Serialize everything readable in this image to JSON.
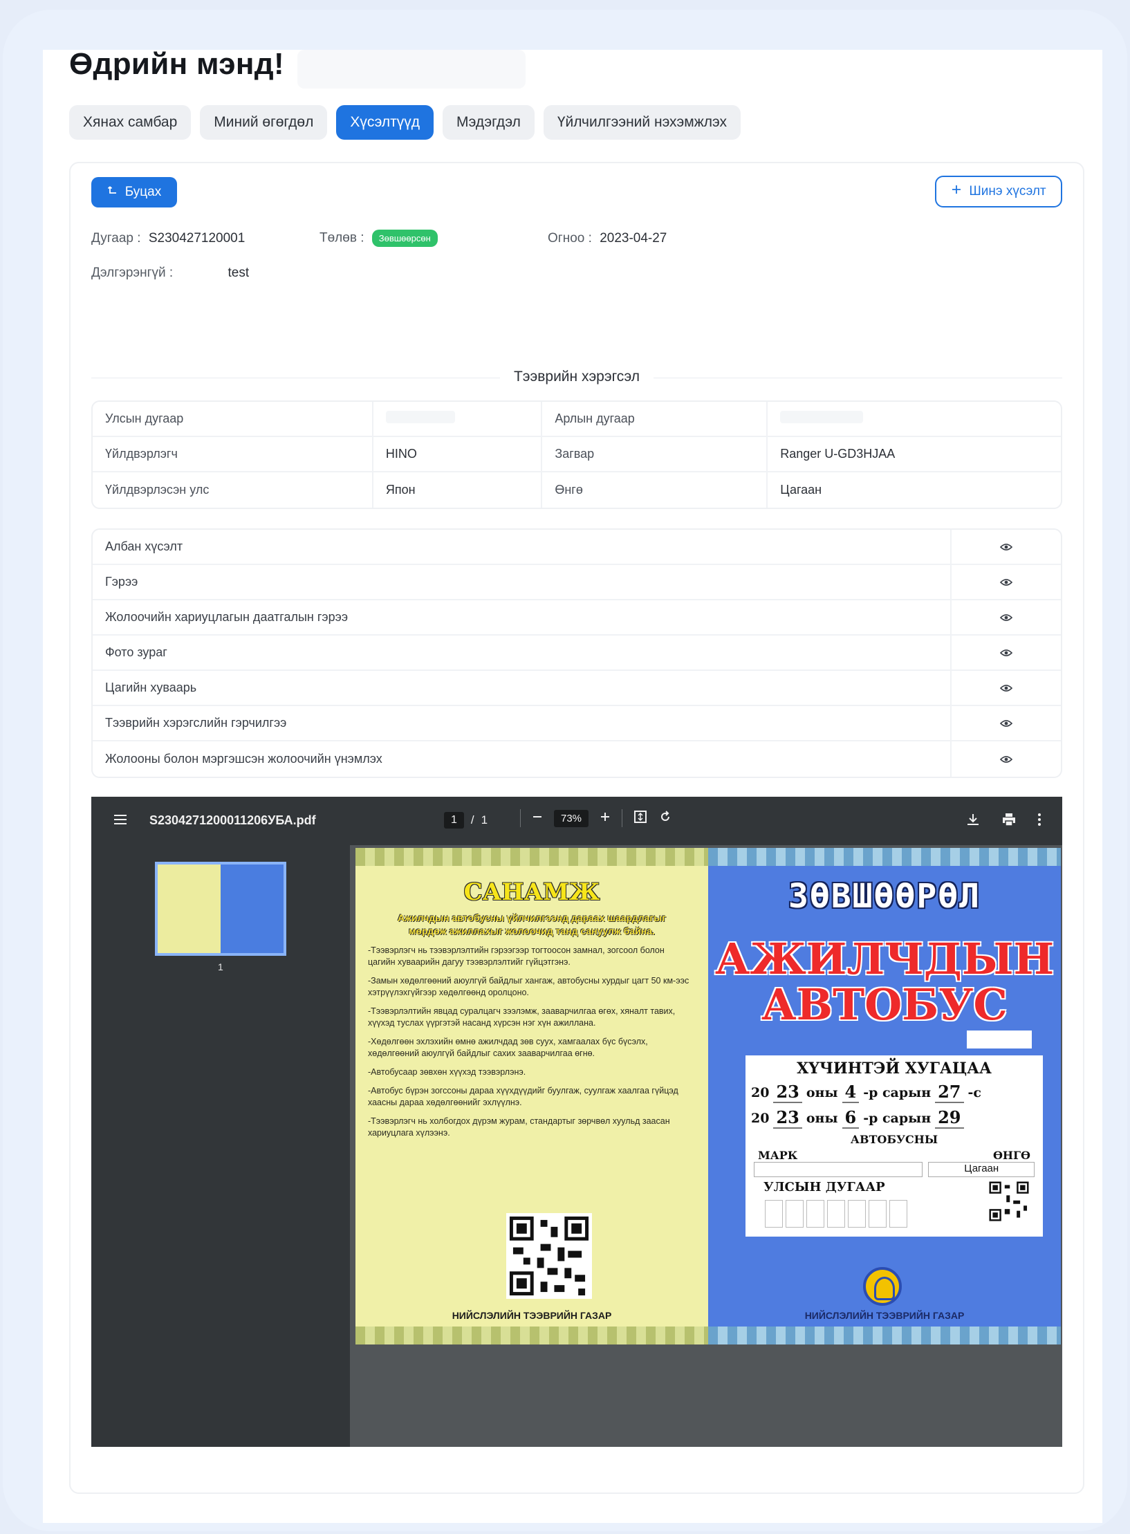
{
  "greeting": "Өдрийн мэнд!",
  "tabs": [
    {
      "label": "Хянах самбар",
      "active": false
    },
    {
      "label": "Миний өгөгдөл",
      "active": false
    },
    {
      "label": "Хүсэлтүүд",
      "active": true
    },
    {
      "label": "Мэдэгдэл",
      "active": false
    },
    {
      "label": "Үйлчилгээний нэхэмжлэх",
      "active": false
    }
  ],
  "actions": {
    "back_label": "Буцах",
    "new_request_label": "Шинэ хүсэлт"
  },
  "request": {
    "number_label": "Дугаар :",
    "number_value": "S230427120001",
    "status_label": "Төлөв :",
    "status_value": "Зөвшөөрсөн",
    "date_label": "Огноо :",
    "date_value": "2023-04-27",
    "detail_label": "Дэлгэрэнгүй :",
    "detail_value": "test"
  },
  "vehicle": {
    "section_title": "Тээврийн хэрэгсэл",
    "rows": [
      {
        "k1": "Улсын дугаар",
        "v1": "",
        "k2": "Арлын дугаар",
        "v2": ""
      },
      {
        "k1": "Үйлдвэрлэгч",
        "v1": "HINO",
        "k2": "Загвар",
        "v2": "Ranger U-GD3HJAA"
      },
      {
        "k1": "Үйлдвэрлэсэн улс",
        "v1": "Япон",
        "k2": "Өнгө",
        "v2": "Цагаан"
      }
    ]
  },
  "documents": [
    "Албан хүсэлт",
    "Гэрээ",
    "Жолоочийн хариуцлагын даатгалын гэрээ",
    "Фото зураг",
    "Цагийн хуваарь",
    "Тээврийн хэрэгслийн гэрчилгээ",
    "Жолооны болон мэргэшсэн жолоочийн үнэмлэх"
  ],
  "viewer": {
    "filename": "S2304271200011206УБА.pdf",
    "page_current": "1",
    "page_sep": "/",
    "page_total": "1",
    "zoom": "73%",
    "thumb_label": "1"
  },
  "pdf": {
    "left_title": "САНАМЖ",
    "left_subtitle": "Ажилчдын автобусны үйлчилгээнд дараах шаардлагыг мөрдөж ажиллахыг жолоочид танд сануулж байна.",
    "bullets": [
      "-Тээвэрлэгч нь тээвэрлэлтийн гэрээгээр тогтоосон замнал, зогсоол болон цагийн хуваарийн дагуу тээвэрлэлтийг гүйцэтгэнэ.",
      "-Замын хөдөлгөөний аюулгүй байдлыг хангаж, автобусны хурдыг цагт 50 км-ээс хэтрүүлэхгүйгээр хөдөлгөөнд оролцоно.",
      "-Тээвэрлэлтийн явцад суралцагч зээлэмж, зааварчилгаа өгөх, хяналт тавих, хүүхэд туслах үүргэтэй насанд хүрсэн нэг хүн ажиллана.",
      "-Хөдөлгөөн эхлэхийн өмнө ажилчдад зөв суух, хамгаалах бүс бүсэлх, хөдөлгөөний аюулгүй байдлыг сахих зааварчилгаа өгнө.",
      "-Автобусаар зөвхөн хүүхэд тээвэрлэнэ.",
      "-Автобус бүрэн зогссоны дараа хүүхдүүдийг буулгаж, суулгаж хаалгаа гүйцэд хаасны дараа хөдөлгөөнийг эхлүүлнэ.",
      "-Тээвэрлэгч нь холбогдох дүрэм журам, стандартыг зөрчвөл хуульд заасан хариуцлага хүлээнэ."
    ],
    "footer": "НИЙСЛЭЛИЙН ТЭЭВРИЙН ГАЗАР",
    "right_title": "ЗӨВШӨӨРӨЛ",
    "right_line1": "АЖИЛЧДЫН",
    "right_line2": "АВТОБУС",
    "validity": "ХҮЧИНТЭЙ ХУГАЦАА",
    "from_prefix": "20",
    "from_year": "23",
    "from_year_suffix": "оны",
    "from_month": "4",
    "from_month_suffix": "-р сарын",
    "from_day": "27",
    "from_day_suffix": "-с",
    "to_prefix": "20",
    "to_year": "23",
    "to_year_suffix": "оны",
    "to_month": "6",
    "to_month_suffix": "-р сарын",
    "to_day": "29",
    "bus_label": "АВТОБУСНЫ",
    "mark_label": "МАРК",
    "color_label": "ӨНГӨ",
    "color_value": "Цагаан",
    "plate_label": "УЛСЫН ДУГААР",
    "right_footer": "НИЙСЛЭЛИЙН ТЭЭВРИЙН ГАЗАР"
  },
  "colors": {
    "primary": "#1f74e0",
    "success": "#2fc26a",
    "viewer_bar": "#323639"
  }
}
